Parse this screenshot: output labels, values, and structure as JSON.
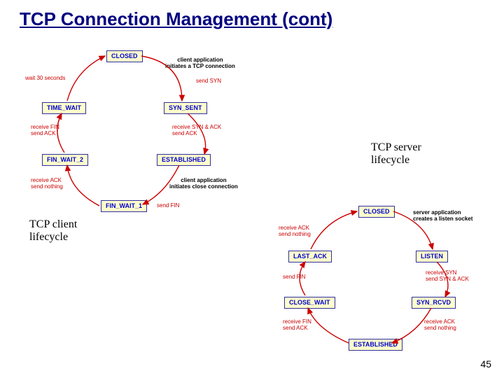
{
  "title": "TCP Connection Management (cont)",
  "page_number": "45",
  "labels": {
    "server": "TCP server\nlifecycle",
    "client": "TCP client\nlifecycle"
  },
  "client": {
    "states": {
      "closed": "CLOSED",
      "syn_sent": "SYN_SENT",
      "established": "ESTABLISHED",
      "fin_wait_1": "FIN_WAIT_1",
      "fin_wait_2": "FIN_WAIT_2",
      "time_wait": "TIME_WAIT"
    },
    "annotations": {
      "init": "client application\ninitiates a TCP connection",
      "send_syn": "send SYN",
      "recv_synack": "receive SYN & ACK\nsend ACK",
      "close": "client application\ninitiates close connection",
      "send_fin": "send FIN",
      "recv_ack": "receive ACK\nsend nothing",
      "recv_fin": "receive FIN\nsend ACK",
      "wait30": "wait 30 seconds"
    }
  },
  "server": {
    "states": {
      "closed": "CLOSED",
      "listen": "LISTEN",
      "syn_rcvd": "SYN_RCVD",
      "established": "ESTABLISHED",
      "close_wait": "CLOSE_WAIT",
      "last_ack": "LAST_ACK"
    },
    "annotations": {
      "create_socket": "server application\ncreates a listen socket",
      "recv_syn": "receive SYN\nsend SYN & ACK",
      "recv_ack": "receive ACK\nsend nothing",
      "recv_fin": "receive FIN\nsend ACK",
      "send_fin": "send FIN",
      "recv_ack2": "receive ACK\nsend nothing"
    }
  },
  "colors": {
    "title": "#000080",
    "box_border": "#3030a0",
    "box_fill": "#ffffcc",
    "box_text": "#0000cc",
    "arrow": "#cc0000",
    "ann_red": "#cc0000",
    "ann_black": "#000000"
  }
}
